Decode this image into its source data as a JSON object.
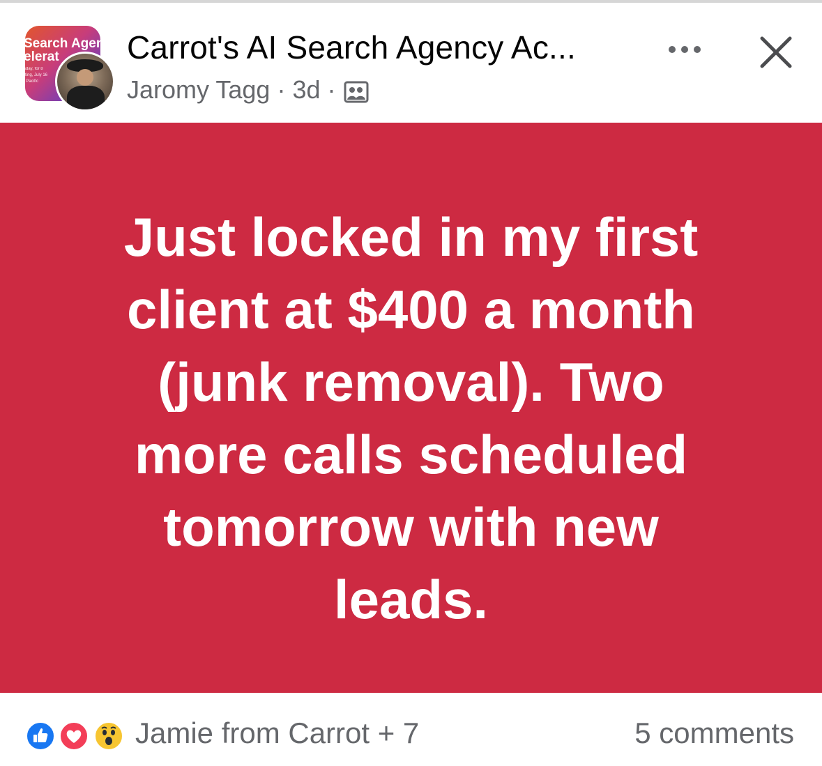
{
  "header": {
    "group_thumbnail": {
      "line1": "Search Agen",
      "line2": "elerat",
      "small_lines": [
        "sday, for 8",
        "rting, July 16",
        "t Pacific"
      ]
    },
    "title": "Carrot's AI Search Agency Ac...",
    "author": "Jaromy Tagg",
    "separator": "·",
    "time": "3d",
    "audience_icon": "group-audience-icon",
    "more_icon": "more-options-icon",
    "close_icon": "close-icon"
  },
  "post": {
    "background_color": "#cd2a42",
    "text_color": "#ffffff",
    "lines": [
      "Just locked in my first",
      "client at $400 a month",
      "(junk removal). Two",
      "more calls scheduled",
      "tomorrow with new",
      "leads."
    ]
  },
  "footer": {
    "reaction_icons": [
      "like-icon",
      "love-icon",
      "wow-icon"
    ],
    "reactors": "Jamie from Carrot + 7",
    "comments": "5 comments"
  }
}
